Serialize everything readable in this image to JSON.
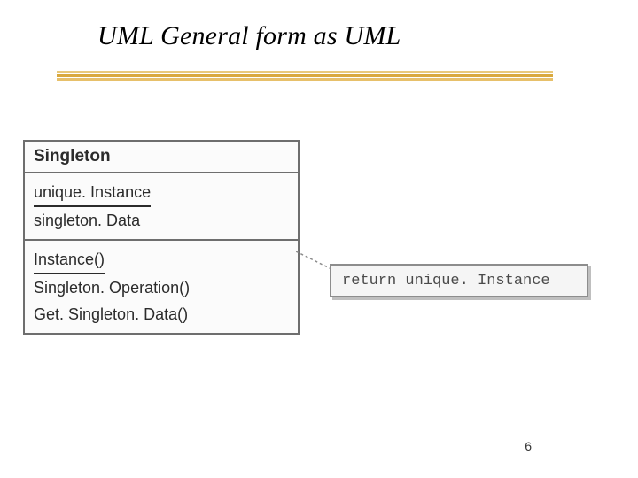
{
  "title": "UML General form as UML",
  "uml_class": {
    "name": "Singleton",
    "attributes": [
      {
        "label": "unique. Instance",
        "static": true
      },
      {
        "label": "singleton. Data",
        "static": false
      }
    ],
    "operations": [
      {
        "label": "Instance()",
        "static": true
      },
      {
        "label": "Singleton. Operation()",
        "static": false
      },
      {
        "label": "Get. Singleton. Data()",
        "static": false
      }
    ]
  },
  "note": {
    "text": "return unique. Instance"
  },
  "page_number": "6"
}
